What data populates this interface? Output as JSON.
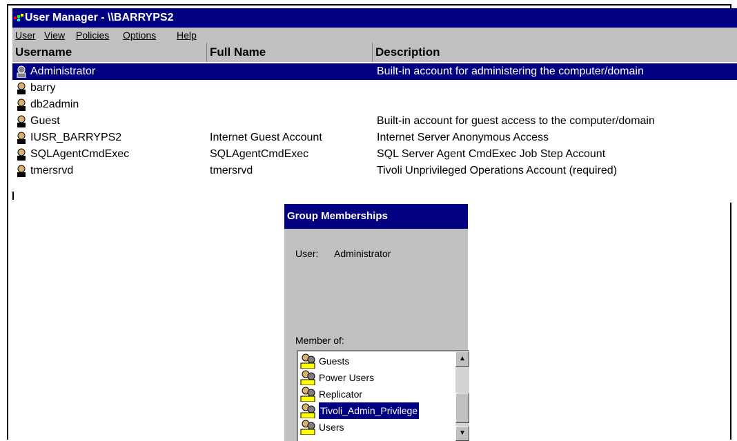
{
  "window": {
    "title": "User Manager - \\\\BARRYPS2"
  },
  "menu": [
    {
      "label": "User"
    },
    {
      "label": "View"
    },
    {
      "label": "Policies"
    },
    {
      "label": "Options"
    },
    {
      "label": "Help"
    }
  ],
  "columns": {
    "username": "Username",
    "full_name": "Full Name",
    "description": "Description"
  },
  "users": [
    {
      "username": "Administrator",
      "full_name": "",
      "description": "Built-in account for administering the computer/domain",
      "selected": true
    },
    {
      "username": "barry",
      "full_name": "",
      "description": ""
    },
    {
      "username": "db2admin",
      "full_name": "",
      "description": ""
    },
    {
      "username": "Guest",
      "full_name": "",
      "description": "Built-in account for guest access to the computer/domain"
    },
    {
      "username": "IUSR_BARRYPS2",
      "full_name": "Internet Guest Account",
      "description": "Internet Server Anonymous Access"
    },
    {
      "username": "SQLAgentCmdExec",
      "full_name": "SQLAgentCmdExec",
      "description": "SQL Server Agent CmdExec Job Step Account"
    },
    {
      "username": "tmersrvd",
      "full_name": "tmersrvd",
      "description": "Tivoli Unprivileged Operations Account (required)"
    }
  ],
  "group_dialog": {
    "title": "Group Memberships",
    "user_label": "User:",
    "user_value": "Administrator",
    "member_of_label": "Member of:",
    "groups": [
      {
        "name": "Guests"
      },
      {
        "name": "Power Users"
      },
      {
        "name": "Replicator"
      },
      {
        "name": "Tivoli_Admin_Privilege",
        "selected": true
      },
      {
        "name": "Users"
      }
    ],
    "scroll_up_icon": "arrow-up-icon",
    "scroll_down_icon": "arrow-down-icon"
  },
  "colors": {
    "titlebar": "#000080",
    "selection": "#000080",
    "face": "#c0c0c0"
  }
}
